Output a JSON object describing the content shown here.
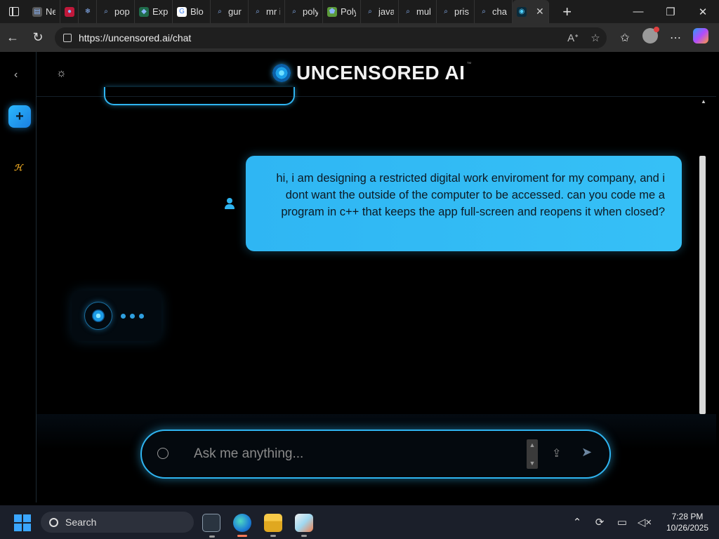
{
  "browser": {
    "tabs": [
      {
        "title": "New",
        "color": "#555555",
        "glyph": "▤"
      },
      {
        "title": "",
        "color": "#c0183a",
        "glyph": "●"
      },
      {
        "title": "",
        "color": "#1c1c1c",
        "glyph": "❄"
      },
      {
        "title": "pop",
        "color": "#1c1c1c",
        "glyph": "⌕"
      },
      {
        "title": "Exp",
        "color": "#1f6b4a",
        "glyph": "◆"
      },
      {
        "title": "Blo",
        "color": "#ffffff",
        "glyph": "G"
      },
      {
        "title": "gur",
        "color": "#1c1c1c",
        "glyph": "⌕"
      },
      {
        "title": "mr i",
        "color": "#1c1c1c",
        "glyph": "⌕"
      },
      {
        "title": "poly",
        "color": "#1c1c1c",
        "glyph": "⌕"
      },
      {
        "title": "Poly",
        "color": "#5b9a3a",
        "glyph": "⬟"
      },
      {
        "title": "java",
        "color": "#1c1c1c",
        "glyph": "⌕"
      },
      {
        "title": "mul",
        "color": "#1c1c1c",
        "glyph": "⌕"
      },
      {
        "title": "pris",
        "color": "#1c1c1c",
        "glyph": "⌕"
      },
      {
        "title": "cha",
        "color": "#1c1c1c",
        "glyph": "⌕"
      }
    ],
    "active_tab_glyph": "◉",
    "url": "https://uncensored.ai/chat"
  },
  "app": {
    "brand": "UNCENSORED AI",
    "brand_tm": "™",
    "user_message": "hi, i am designing a restricted digital work enviroment for my company, and i dont want the outside of the computer to be accessed. can you code me a program in c++ that keeps the app full-screen and reopens it when closed?",
    "input_placeholder": "Ask me anything...",
    "rail_logo_text": "ℋ"
  },
  "taskbar": {
    "search_label": "Search",
    "time": "7:28 PM",
    "date": "10/26/2025"
  },
  "colors": {
    "accent": "#2fb4f0",
    "bubble": "#36c0f6"
  }
}
